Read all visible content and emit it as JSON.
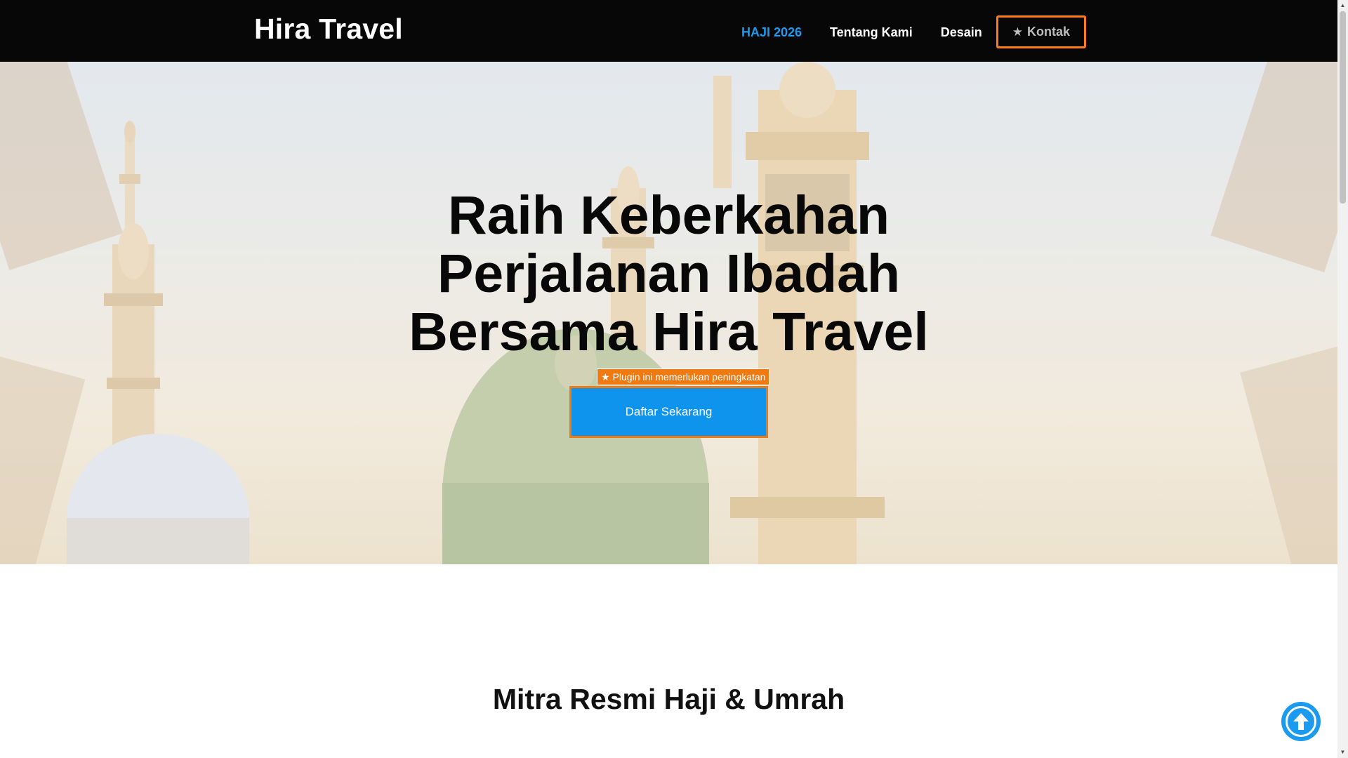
{
  "header": {
    "brand": "Hira Travel",
    "nav": [
      {
        "label": "HAJI 2026",
        "active": true
      },
      {
        "label": "Tentang Kami",
        "active": false
      },
      {
        "label": "Desain",
        "active": false
      }
    ],
    "contact_label": "Kontak",
    "contact_icon": "star-icon"
  },
  "hero": {
    "title_line1": "Raih Keberkahan",
    "title_line2": "Perjalanan Ibadah",
    "title_line3": "Bersama Hira Travel",
    "plugin_note": "Plugin ini memerlukan peningkatan",
    "cta_label": "Daftar Sekarang"
  },
  "section": {
    "title": "Mitra Resmi Haji & Umrah"
  },
  "colors": {
    "header_bg": "#070707",
    "accent_blue": "#1a9bf0",
    "cta_blue": "#0f94ee",
    "accent_orange": "#f07a12"
  },
  "icons": {
    "back_to_top": "arrow-up-circle-icon"
  }
}
